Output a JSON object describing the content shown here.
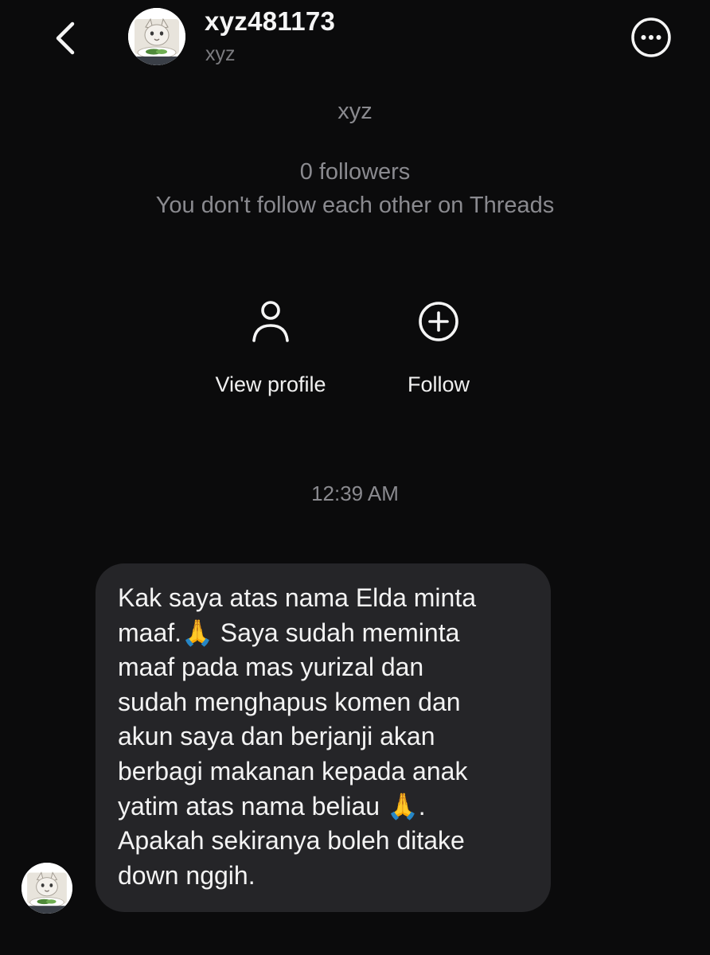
{
  "header": {
    "back_icon": "chevron-left-icon",
    "username": "xyz481173",
    "subname": "xyz",
    "more_icon": "more-horizontal-circle-icon"
  },
  "profile": {
    "name": "xyz",
    "followers": "0 followers",
    "follow_status": "You don't follow each other on Threads"
  },
  "actions": {
    "view_profile": {
      "icon": "person-icon",
      "label": "View profile"
    },
    "follow": {
      "icon": "plus-circle-icon",
      "label": "Follow"
    }
  },
  "conversation": {
    "timestamp": "12:39 AM",
    "message": "Kak saya atas nama Elda minta\nmaaf.🙏 Saya sudah meminta\nmaaf pada mas yurizal dan\nsudah menghapus komen dan\nakun saya dan berjanji akan\nberbagi makanan kepada anak\nyatim atas nama beliau 🙏.\nApakah sekiranya boleh ditake\ndown nggih."
  },
  "colors": {
    "background": "#0b0b0c",
    "bubble": "#252528",
    "primary_text": "#f2f2f2",
    "secondary_text": "#8a8a8f"
  }
}
